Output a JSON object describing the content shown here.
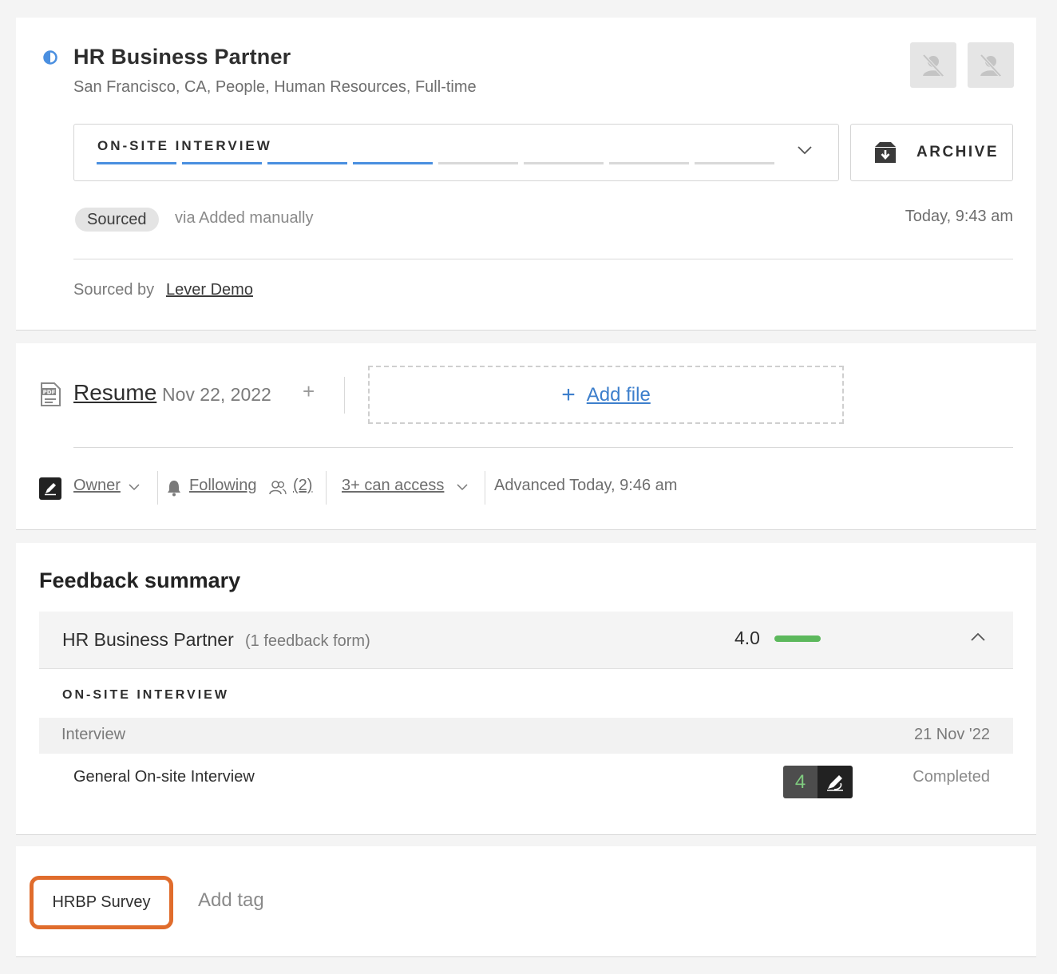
{
  "header": {
    "title": "HR Business Partner",
    "subtitle": "San Francisco, CA, People, Human Resources, Full-time",
    "status_color": "#4a8fe0"
  },
  "stage": {
    "label": "ON-SITE INTERVIEW",
    "completed_steps": 4,
    "total_steps": 8,
    "icon": "chevron-down-icon"
  },
  "archive": {
    "label": "ARCHIVE",
    "icon": "archive-box-icon"
  },
  "source": {
    "pill": "Sourced",
    "via": "via Added manually",
    "time": "Today, 9:43 am",
    "sourced_by_label": "Sourced by",
    "sourced_by_name": "Lever Demo"
  },
  "files": {
    "resume_label": "Resume",
    "resume_date": "Nov 22, 2022",
    "add_file_label": "Add file"
  },
  "meta": {
    "owner_label": "Owner",
    "following_label": "Following",
    "followers_count": "(2)",
    "access_label": "3+ can access",
    "advanced_text": "Advanced Today, 9:46 am"
  },
  "feedback": {
    "title": "Feedback summary",
    "job": "HR Business Partner",
    "form_count": "(1 feedback form)",
    "score": "4.0",
    "score_color": "#5cb85c",
    "stage": "ON-SITE INTERVIEW",
    "row_header_left": "Interview",
    "row_header_right": "21 Nov '22",
    "interview_name": "General On-site Interview",
    "interview_score": "4",
    "interview_status": "Completed"
  },
  "tags": {
    "items": [
      "HRBP Survey"
    ],
    "add_label": "Add tag",
    "highlight_color": "#e06c2c"
  }
}
